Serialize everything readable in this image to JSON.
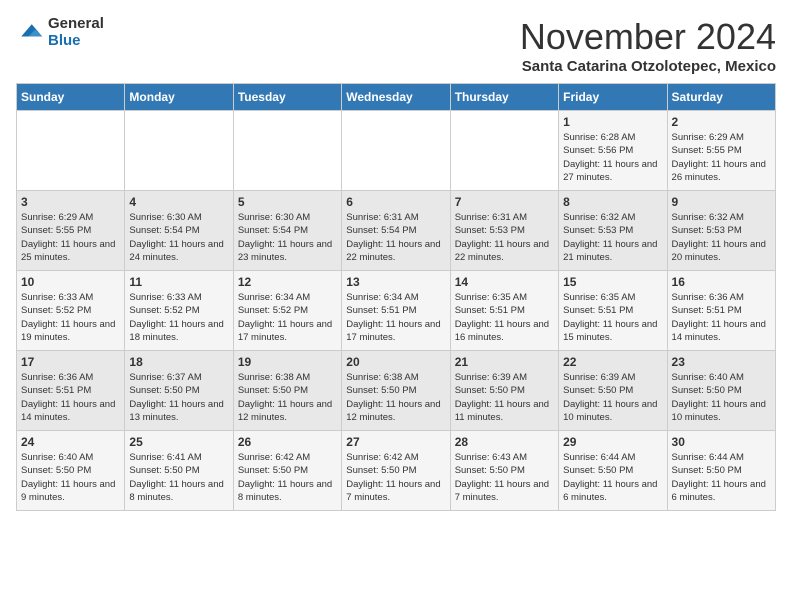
{
  "logo": {
    "general": "General",
    "blue": "Blue"
  },
  "header": {
    "month": "November 2024",
    "location": "Santa Catarina Otzolotepec, Mexico"
  },
  "weekdays": [
    "Sunday",
    "Monday",
    "Tuesday",
    "Wednesday",
    "Thursday",
    "Friday",
    "Saturday"
  ],
  "weeks": [
    [
      {
        "day": null
      },
      {
        "day": null
      },
      {
        "day": null
      },
      {
        "day": null
      },
      {
        "day": null
      },
      {
        "day": "1",
        "sunrise": "6:28 AM",
        "sunset": "5:56 PM",
        "daylight": "11 hours and 27 minutes."
      },
      {
        "day": "2",
        "sunrise": "6:29 AM",
        "sunset": "5:55 PM",
        "daylight": "11 hours and 26 minutes."
      }
    ],
    [
      {
        "day": "3",
        "sunrise": "6:29 AM",
        "sunset": "5:55 PM",
        "daylight": "11 hours and 25 minutes."
      },
      {
        "day": "4",
        "sunrise": "6:30 AM",
        "sunset": "5:54 PM",
        "daylight": "11 hours and 24 minutes."
      },
      {
        "day": "5",
        "sunrise": "6:30 AM",
        "sunset": "5:54 PM",
        "daylight": "11 hours and 23 minutes."
      },
      {
        "day": "6",
        "sunrise": "6:31 AM",
        "sunset": "5:54 PM",
        "daylight": "11 hours and 22 minutes."
      },
      {
        "day": "7",
        "sunrise": "6:31 AM",
        "sunset": "5:53 PM",
        "daylight": "11 hours and 22 minutes."
      },
      {
        "day": "8",
        "sunrise": "6:32 AM",
        "sunset": "5:53 PM",
        "daylight": "11 hours and 21 minutes."
      },
      {
        "day": "9",
        "sunrise": "6:32 AM",
        "sunset": "5:53 PM",
        "daylight": "11 hours and 20 minutes."
      }
    ],
    [
      {
        "day": "10",
        "sunrise": "6:33 AM",
        "sunset": "5:52 PM",
        "daylight": "11 hours and 19 minutes."
      },
      {
        "day": "11",
        "sunrise": "6:33 AM",
        "sunset": "5:52 PM",
        "daylight": "11 hours and 18 minutes."
      },
      {
        "day": "12",
        "sunrise": "6:34 AM",
        "sunset": "5:52 PM",
        "daylight": "11 hours and 17 minutes."
      },
      {
        "day": "13",
        "sunrise": "6:34 AM",
        "sunset": "5:51 PM",
        "daylight": "11 hours and 17 minutes."
      },
      {
        "day": "14",
        "sunrise": "6:35 AM",
        "sunset": "5:51 PM",
        "daylight": "11 hours and 16 minutes."
      },
      {
        "day": "15",
        "sunrise": "6:35 AM",
        "sunset": "5:51 PM",
        "daylight": "11 hours and 15 minutes."
      },
      {
        "day": "16",
        "sunrise": "6:36 AM",
        "sunset": "5:51 PM",
        "daylight": "11 hours and 14 minutes."
      }
    ],
    [
      {
        "day": "17",
        "sunrise": "6:36 AM",
        "sunset": "5:51 PM",
        "daylight": "11 hours and 14 minutes."
      },
      {
        "day": "18",
        "sunrise": "6:37 AM",
        "sunset": "5:50 PM",
        "daylight": "11 hours and 13 minutes."
      },
      {
        "day": "19",
        "sunrise": "6:38 AM",
        "sunset": "5:50 PM",
        "daylight": "11 hours and 12 minutes."
      },
      {
        "day": "20",
        "sunrise": "6:38 AM",
        "sunset": "5:50 PM",
        "daylight": "11 hours and 12 minutes."
      },
      {
        "day": "21",
        "sunrise": "6:39 AM",
        "sunset": "5:50 PM",
        "daylight": "11 hours and 11 minutes."
      },
      {
        "day": "22",
        "sunrise": "6:39 AM",
        "sunset": "5:50 PM",
        "daylight": "11 hours and 10 minutes."
      },
      {
        "day": "23",
        "sunrise": "6:40 AM",
        "sunset": "5:50 PM",
        "daylight": "11 hours and 10 minutes."
      }
    ],
    [
      {
        "day": "24",
        "sunrise": "6:40 AM",
        "sunset": "5:50 PM",
        "daylight": "11 hours and 9 minutes."
      },
      {
        "day": "25",
        "sunrise": "6:41 AM",
        "sunset": "5:50 PM",
        "daylight": "11 hours and 8 minutes."
      },
      {
        "day": "26",
        "sunrise": "6:42 AM",
        "sunset": "5:50 PM",
        "daylight": "11 hours and 8 minutes."
      },
      {
        "day": "27",
        "sunrise": "6:42 AM",
        "sunset": "5:50 PM",
        "daylight": "11 hours and 7 minutes."
      },
      {
        "day": "28",
        "sunrise": "6:43 AM",
        "sunset": "5:50 PM",
        "daylight": "11 hours and 7 minutes."
      },
      {
        "day": "29",
        "sunrise": "6:44 AM",
        "sunset": "5:50 PM",
        "daylight": "11 hours and 6 minutes."
      },
      {
        "day": "30",
        "sunrise": "6:44 AM",
        "sunset": "5:50 PM",
        "daylight": "11 hours and 6 minutes."
      }
    ]
  ],
  "labels": {
    "sunrise": "Sunrise:",
    "sunset": "Sunset:",
    "daylight": "Daylight hours"
  },
  "colors": {
    "header_bg": "#3278b5",
    "accent": "#1a6faf"
  }
}
